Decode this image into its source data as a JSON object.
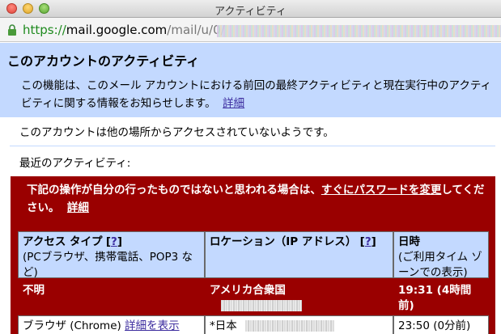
{
  "window": {
    "title": "アクティビティ"
  },
  "address_bar": {
    "scheme": "https://",
    "host": "mail.google.com",
    "path": "/mail/u/0/"
  },
  "header": {
    "title": "このアカウントのアクティビティ",
    "description": "この機能は、このメール アカウントにおける前回の最終アクティビティと現在実行中のアクティビティに関する情報をお知らせします。",
    "details_link": "詳細"
  },
  "status": {
    "message": "このアカウントは他の場所からアクセスされていないようです。"
  },
  "recent": {
    "title": "最近のアクティビティ:"
  },
  "warning": {
    "text_before": "下記の操作が自分の行ったものではないと思われる場合は、",
    "link": "すぐにパスワードを変更",
    "text_after": "してください。",
    "details_link": "詳細"
  },
  "table": {
    "columns": [
      {
        "title": "アクセス タイプ",
        "help": "?",
        "sub": "(PCブラウザ、携帯電話、POP3 など)"
      },
      {
        "title": "ロケーション（IP アドレス）",
        "help": "?",
        "sub": ""
      },
      {
        "title": "日時",
        "help": "",
        "sub": "(ご利用タイム ゾーンでの表示)"
      }
    ],
    "rows": [
      {
        "access": "不明",
        "access_link": "",
        "location": "アメリカ合衆国",
        "time": "19:31 (4時間前)"
      },
      {
        "access": "ブラウザ (Chrome)",
        "access_link": "詳細を表示",
        "location": "*日本",
        "time": "23:50 (0分前)"
      }
    ]
  },
  "colors": {
    "header_bg": "#c3d9ff",
    "warning_bg": "#9a0000",
    "link": "#3b2b9e",
    "url_scheme": "#1e8a1e"
  },
  "icons": [
    "close-icon",
    "minimize-icon",
    "zoom-icon",
    "lock-icon"
  ]
}
